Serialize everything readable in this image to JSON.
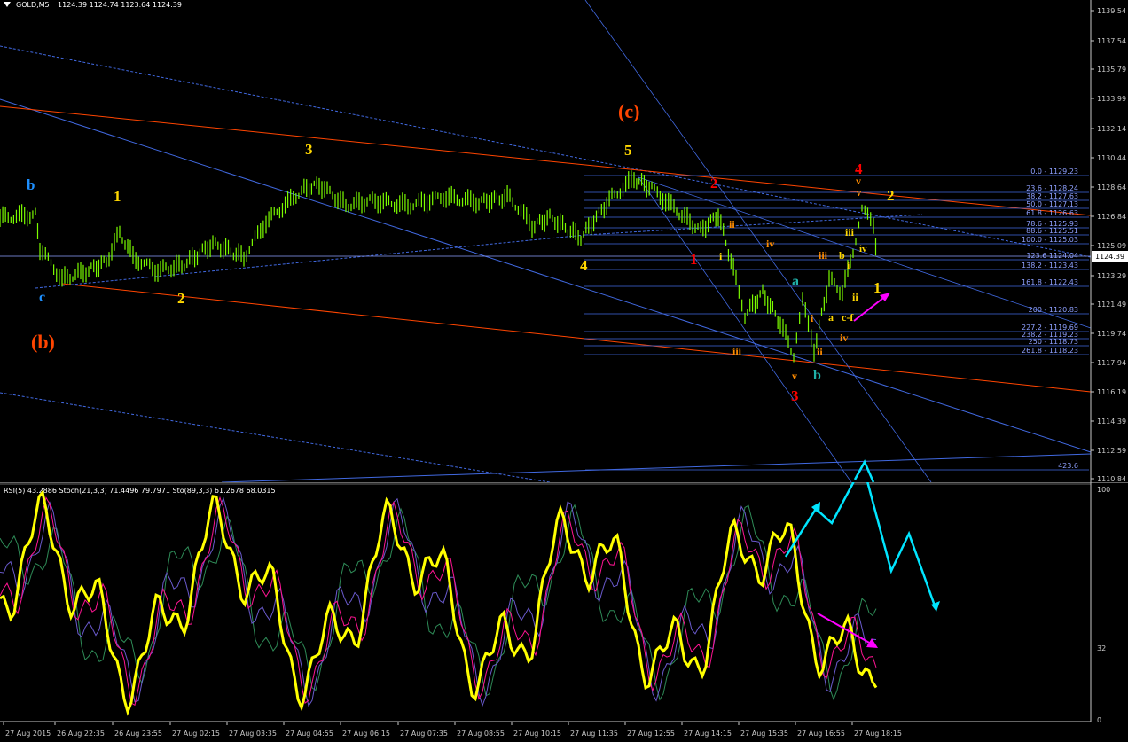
{
  "header": {
    "symbol": "GOLD,M5",
    "ohlc": "1124.39 1124.74 1123.64 1124.39",
    "indicators": "RSI(5) 43.2886  Stoch(21,3,3) 71.4496 79.7971  Sto(89,3,3) 61.2678 68.0315"
  },
  "price_axis": [
    "1139.54",
    "1137.54",
    "1135.79",
    "1133.99",
    "1132.14",
    "1130.44",
    "1128.64",
    "1126.84",
    "1125.09",
    "1124.39",
    "1123.29",
    "1121.49",
    "1119.74",
    "1117.94",
    "1116.19",
    "1114.39",
    "1112.59",
    "1110.84"
  ],
  "current_price": "1124.39",
  "osc_axis": [
    "100",
    "32",
    "0"
  ],
  "time_axis": [
    "27 Aug 2015",
    "26 Aug 22:35",
    "26 Aug 23:55",
    "27 Aug 02:15",
    "27 Aug 03:35",
    "27 Aug 04:55",
    "27 Aug 06:15",
    "27 Aug 07:35",
    "27 Aug 08:55",
    "27 Aug 10:15",
    "27 Aug 11:35",
    "27 Aug 12:55",
    "27 Aug 14:15",
    "27 Aug 15:35",
    "27 Aug 16:55",
    "27 Aug 18:15"
  ],
  "fib_levels": [
    {
      "label": "0.0 - 1129.23"
    },
    {
      "label": "23.6 - 1128.24"
    },
    {
      "label": "38.2 - 1127.63"
    },
    {
      "label": "50.0 - 1127.13"
    },
    {
      "label": "61.8 - 1126.63"
    },
    {
      "label": "78.6 - 1125.93"
    },
    {
      "label": "88.6 - 1125.51"
    },
    {
      "label": "100.0 - 1125.03"
    },
    {
      "label": "123.6 1124.04"
    },
    {
      "label": "138.2 - 1123.43"
    },
    {
      "label": "161.8 - 1122.43"
    },
    {
      "label": "200 - 1120.83"
    },
    {
      "label": "227.2 - 1119.69"
    },
    {
      "label": "238.2 - 1119.23"
    },
    {
      "label": "250 - 1118.73"
    },
    {
      "label": "261.8 - 1118.23"
    },
    {
      "label": "423.6"
    }
  ],
  "wave_labels": [
    {
      "text": "b",
      "color": "#1e90ff"
    },
    {
      "text": "1",
      "color": "#ffd700"
    },
    {
      "text": "3",
      "color": "#ffd700"
    },
    {
      "text": "c",
      "color": "#1e90ff"
    },
    {
      "text": "2",
      "color": "#ffd700"
    },
    {
      "text": "(b)",
      "color": "#ff4500"
    },
    {
      "text": "(c)",
      "color": "#ff4500"
    },
    {
      "text": "5",
      "color": "#ffd700"
    },
    {
      "text": "4",
      "color": "#ffd700"
    },
    {
      "text": "2",
      "color": "#ff0000"
    },
    {
      "text": "1",
      "color": "#ff0000"
    },
    {
      "text": "i",
      "color": "#ffd700"
    },
    {
      "text": "ii",
      "color": "#ff8c00"
    },
    {
      "text": "iii",
      "color": "#ff8c00"
    },
    {
      "text": "iv",
      "color": "#ff8c00"
    },
    {
      "text": "v",
      "color": "#ff8c00"
    },
    {
      "text": "3",
      "color": "#ff0000"
    },
    {
      "text": "a",
      "color": "#20b2aa"
    },
    {
      "text": "b",
      "color": "#20b2aa"
    },
    {
      "text": "i",
      "color": "#ff8c00"
    },
    {
      "text": "ii",
      "color": "#ff8c00"
    },
    {
      "text": "a",
      "color": "#ffd700"
    },
    {
      "text": "c-f",
      "color": "#ffd700"
    },
    {
      "text": "iv",
      "color": "#ff8c00"
    },
    {
      "text": "iii",
      "color": "#ff8c00"
    },
    {
      "text": "b",
      "color": "#ffd700"
    },
    {
      "text": "i",
      "color": "#ffd700"
    },
    {
      "text": "ii",
      "color": "#ffd700"
    },
    {
      "text": "iii",
      "color": "#ffd700"
    },
    {
      "text": "iv",
      "color": "#ffd700"
    },
    {
      "text": "4",
      "color": "#ff0000"
    },
    {
      "text": "v",
      "color": "#ff8c00"
    },
    {
      "text": "v",
      "color": "#ff8c00"
    },
    {
      "text": "2",
      "color": "#ffd700"
    },
    {
      "text": "1",
      "color": "#ffd700"
    }
  ],
  "colors": {
    "background": "#000000",
    "candle": "#7cfc00",
    "grid_text": "#c8c8c8",
    "channel_blue": "#4169e1",
    "trend_red": "#ff4500",
    "rsi": "#ffff00",
    "arrow_cyan": "#00e5ff",
    "arrow_magenta": "#ff00ff"
  }
}
